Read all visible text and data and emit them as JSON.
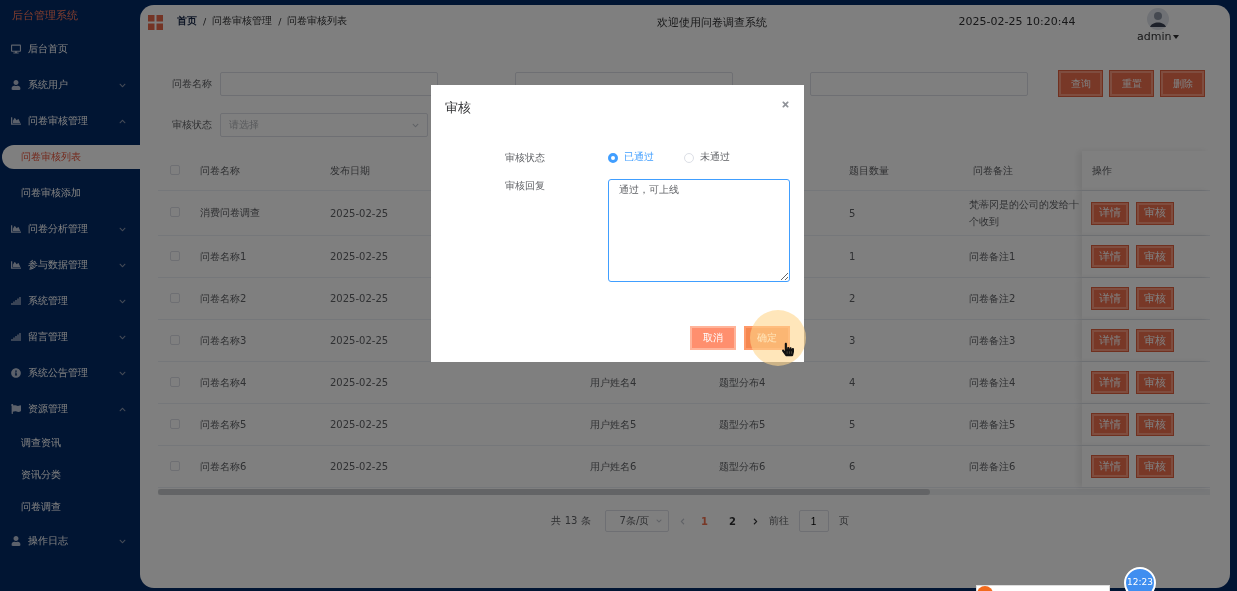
{
  "sidebar": {
    "title": "后台管理系统",
    "items": [
      {
        "label": "后台首页",
        "selected": false
      },
      {
        "label": "系统用户",
        "selected": false,
        "expanded": false
      },
      {
        "label": "问卷审核管理",
        "selected": false,
        "expanded": true,
        "children": [
          {
            "label": "问卷审核列表",
            "selected": true
          },
          {
            "label": "问卷审核添加",
            "selected": false
          }
        ]
      },
      {
        "label": "问卷分析管理",
        "selected": false,
        "expanded": false
      },
      {
        "label": "参与数据管理",
        "selected": false,
        "expanded": false
      },
      {
        "label": "系统管理",
        "selected": false,
        "expanded": false
      },
      {
        "label": "留言管理",
        "selected": false,
        "expanded": false
      },
      {
        "label": "系统公告管理",
        "selected": false,
        "expanded": false
      },
      {
        "label": "资源管理",
        "selected": false,
        "expanded": true,
        "children": [
          {
            "label": "调查资讯",
            "selected": false
          },
          {
            "label": "资讯分类",
            "selected": false
          },
          {
            "label": "问卷调查",
            "selected": false
          }
        ]
      },
      {
        "label": "操作日志",
        "selected": false,
        "expanded": false
      }
    ]
  },
  "header": {
    "breadcrumb": [
      "首页",
      "问卷审核管理",
      "问卷审核列表"
    ],
    "separator": "/",
    "welcome": "欢迎使用问卷调查系统",
    "datetime": "2025-02-25 10:20:44",
    "user": "admin"
  },
  "search": {
    "fields": [
      {
        "label": "问卷名称",
        "kind": "input"
      },
      {
        "kind": "input"
      },
      {
        "kind": "input"
      },
      {
        "label": "审核状态",
        "kind": "select",
        "placeholder": "请选择"
      }
    ],
    "buttons": [
      "查询",
      "重置",
      "删除"
    ]
  },
  "table": {
    "select_all": {
      "checked": false
    },
    "columns": [
      "问卷名称",
      "发布日期",
      null,
      null,
      "题目数量",
      "问卷备注",
      "操作"
    ],
    "rows": [
      {
        "checked": false,
        "cells": [
          "消费问卷调查",
          "2025-02-25",
          null,
          null,
          "5",
          "梵蒂冈是的公司的发给十个收到"
        ],
        "actions": [
          "详情",
          "审核"
        ]
      },
      {
        "checked": false,
        "cells": [
          "问卷名称1",
          "2025-02-25",
          null,
          null,
          "1",
          "问卷备注1"
        ],
        "actions": [
          "详情",
          "审核"
        ]
      },
      {
        "checked": false,
        "cells": [
          "问卷名称2",
          "2025-02-25",
          null,
          null,
          "2",
          "问卷备注2"
        ],
        "actions": [
          "详情",
          "审核"
        ]
      },
      {
        "checked": false,
        "cells": [
          "问卷名称3",
          "2025-02-25",
          null,
          null,
          "3",
          "问卷备注3"
        ],
        "actions": [
          "详情",
          "审核"
        ]
      },
      {
        "checked": false,
        "cells": [
          "问卷名称4",
          "2025-02-25",
          "用户姓名4",
          "题型分布4",
          "4",
          "问卷备注4"
        ],
        "actions": [
          "详情",
          "审核"
        ]
      },
      {
        "checked": false,
        "cells": [
          "问卷名称5",
          "2025-02-25",
          "用户姓名5",
          "题型分布5",
          "5",
          "问卷备注5"
        ],
        "actions": [
          "详情",
          "审核"
        ]
      },
      {
        "checked": false,
        "cells": [
          "问卷名称6",
          "2025-02-25",
          "用户姓名6",
          "题型分布6",
          "6",
          "问卷备注6"
        ],
        "actions": [
          "详情",
          "审核"
        ]
      }
    ]
  },
  "pagination": {
    "total": "共 13 条",
    "page_size": "7条/页",
    "pages": [
      {
        "label": "1",
        "selected": true
      },
      {
        "label": "2",
        "selected": false
      }
    ],
    "goto_label": "前往",
    "goto_value": "1",
    "goto_suffix": "页"
  },
  "dialog": {
    "title": "审核",
    "status_label": "审核状态",
    "options": [
      {
        "label": "已通过",
        "selected": true
      },
      {
        "label": "未通过",
        "selected": false
      }
    ],
    "reply_label": "审核回复",
    "reply_value": "通过，可上线",
    "buttons": [
      {
        "label": "取消",
        "kind": "cancel"
      },
      {
        "label": "确定",
        "kind": "confirm"
      }
    ]
  },
  "clock_badge": "12:23"
}
